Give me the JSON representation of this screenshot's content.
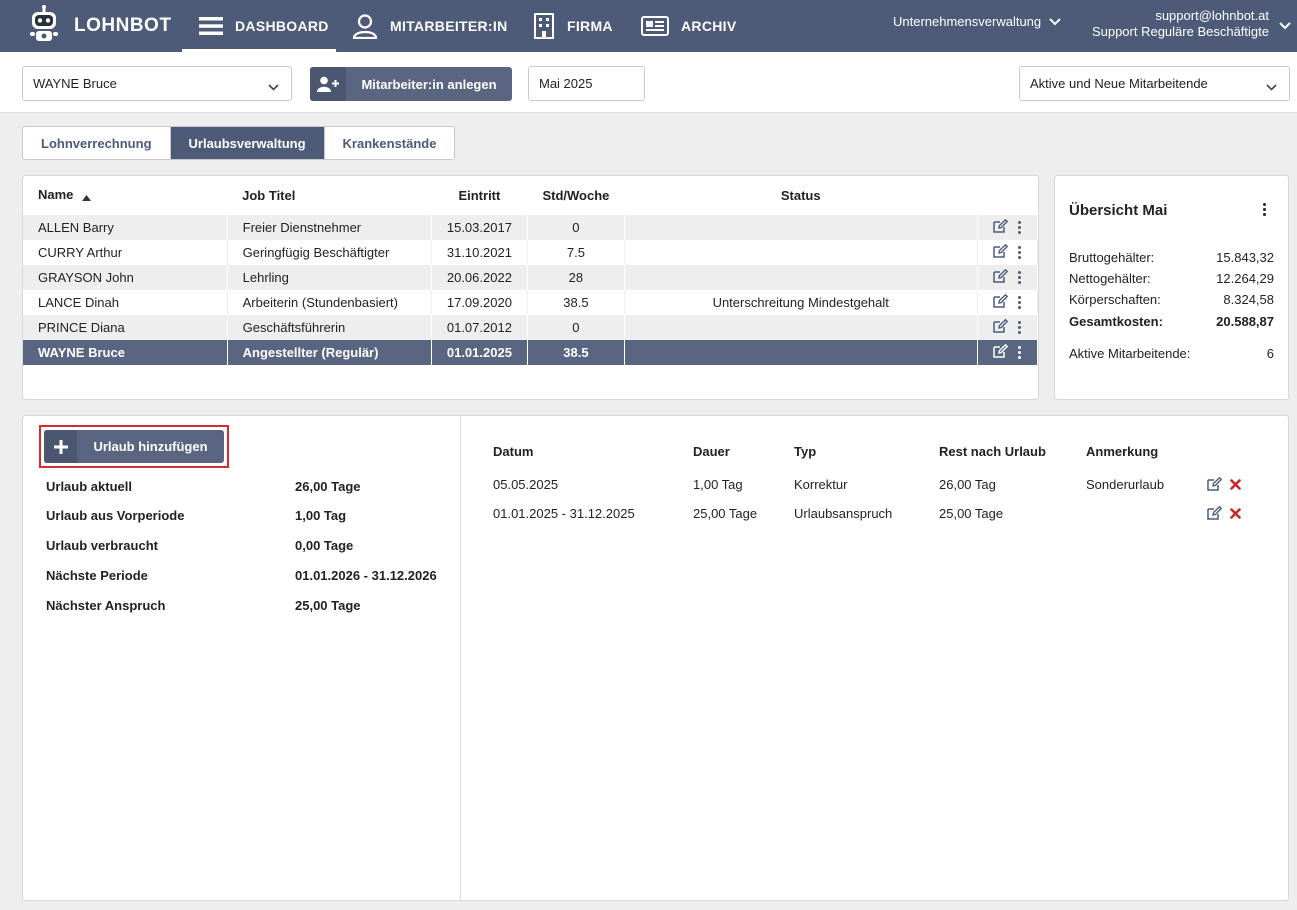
{
  "colors": {
    "nav_bg": "#4d5a78",
    "accent": "#5a6681",
    "highlight_border": "#d92b2b",
    "delete": "#c62828"
  },
  "nav": {
    "brand": "LOHNBOT",
    "items": [
      {
        "label": "DASHBOARD",
        "icon": "hamburger-icon",
        "active": true
      },
      {
        "label": "MITARBEITER:IN",
        "icon": "user-icon"
      },
      {
        "label": "FIRMA",
        "icon": "building-icon"
      },
      {
        "label": "ARCHIV",
        "icon": "newspaper-icon"
      }
    ],
    "company": "Unternehmensverwaltung",
    "account_email": "support@lohnbot.at",
    "account_role": "Support Reguläre Beschäftigte"
  },
  "toolbar": {
    "employee_select": "WAYNE Bruce",
    "add_employee_label": "Mitarbeiter:in anlegen",
    "month": "Mai 2025",
    "filter_select": "Aktive und Neue Mitarbeitende"
  },
  "tabs": [
    {
      "label": "Lohnverrechnung",
      "active": false
    },
    {
      "label": "Urlaubsverwaltung",
      "active": true
    },
    {
      "label": "Krankenstände",
      "active": false
    }
  ],
  "employees": {
    "columns": [
      "Name",
      "Job Titel",
      "Eintritt",
      "Std/Woche",
      "Status"
    ],
    "rows": [
      {
        "name": "ALLEN Barry",
        "job": "Freier Dienstnehmer",
        "start": "15.03.2017",
        "hours": "0",
        "status": ""
      },
      {
        "name": "CURRY Arthur",
        "job": "Geringfügig Beschäftigter",
        "start": "31.10.2021",
        "hours": "7.5",
        "status": ""
      },
      {
        "name": "GRAYSON John",
        "job": "Lehrling",
        "start": "20.06.2022",
        "hours": "28",
        "status": ""
      },
      {
        "name": "LANCE Dinah",
        "job": "Arbeiterin (Stundenbasiert)",
        "start": "17.09.2020",
        "hours": "38.5",
        "status": "Unterschreitung Mindestgehalt"
      },
      {
        "name": "PRINCE Diana",
        "job": "Geschäftsführerin",
        "start": "01.07.2012",
        "hours": "0",
        "status": ""
      },
      {
        "name": "WAYNE Bruce",
        "job": "Angestellter (Regulär)",
        "start": "01.01.2025",
        "hours": "38.5",
        "status": "",
        "selected": true
      }
    ]
  },
  "overview": {
    "title": "Übersicht Mai",
    "gross_label": "Bruttogehälter:",
    "gross": "15.843,32",
    "net_label": "Nettogehälter:",
    "net": "12.264,29",
    "corp_label": "Körperschaften:",
    "corp": "8.324,58",
    "total_label": "Gesamtkosten:",
    "total": "20.588,87",
    "active_label": "Aktive Mitarbeitende:",
    "active": "6"
  },
  "vacation": {
    "add_label": "Urlaub hinzufügen",
    "summary": [
      {
        "label": "Urlaub aktuell",
        "value": "26,00 Tage"
      },
      {
        "label": "Urlaub aus Vorperiode",
        "value": "1,00 Tag"
      },
      {
        "label": "Urlaub verbraucht",
        "value": "0,00 Tage"
      },
      {
        "label": "Nächste Periode",
        "value": "01.01.2026 - 31.12.2026"
      },
      {
        "label": "Nächster Anspruch",
        "value": "25,00 Tage"
      }
    ],
    "columns": [
      "Datum",
      "Dauer",
      "Typ",
      "Rest nach Urlaub",
      "Anmerkung"
    ],
    "entries": [
      {
        "date": "05.05.2025",
        "duration": "1,00 Tag",
        "type": "Korrektur",
        "rest": "26,00 Tag",
        "note": "Sonderurlaub"
      },
      {
        "date": "01.01.2025 - 31.12.2025",
        "duration": "25,00 Tage",
        "type": "Urlaubsanspruch",
        "rest": "25,00 Tage",
        "note": ""
      }
    ]
  }
}
